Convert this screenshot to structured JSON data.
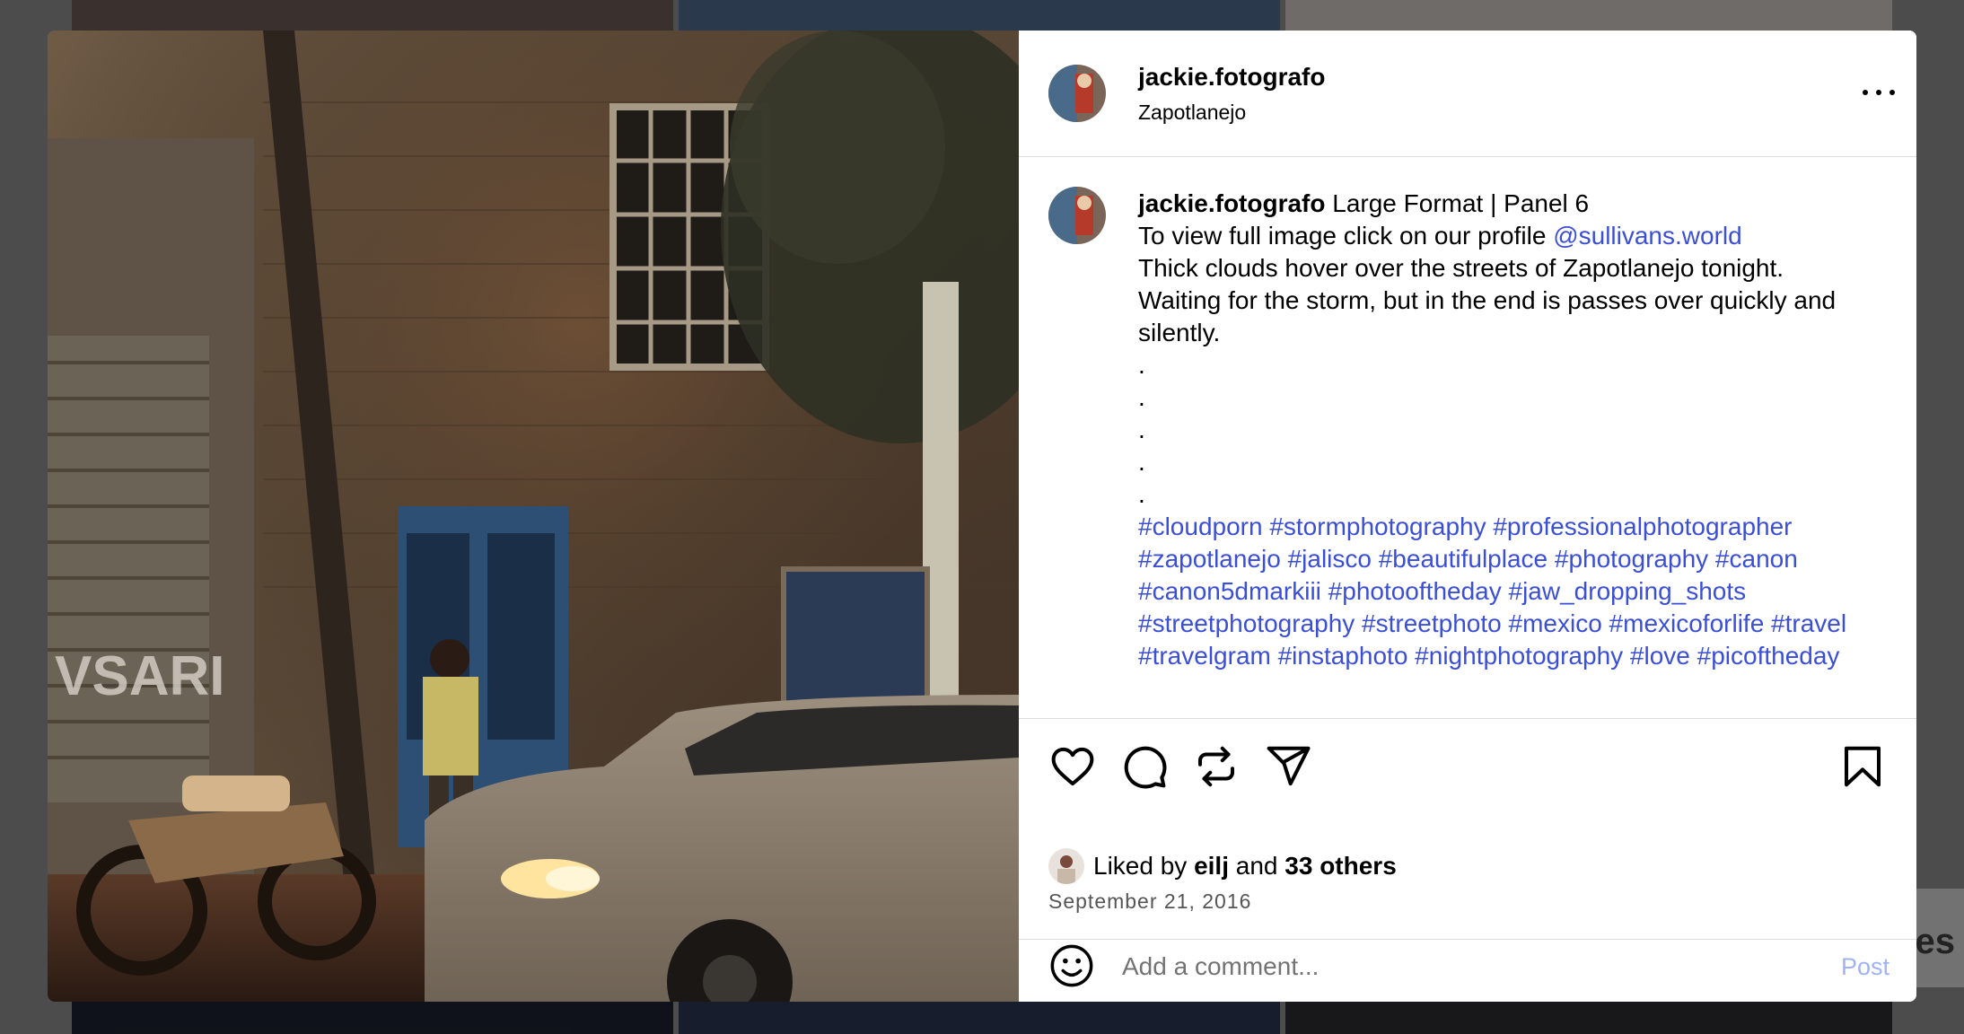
{
  "post": {
    "username": "jackie.fotografo",
    "location": "Zapotlanejo",
    "caption": {
      "title": "Large Format | Panel 6",
      "line1": "To view full image click on our profile",
      "mention": "@sullivans.world",
      "line2": "Thick clouds hover over the streets of Zapotlanejo tonight. Waiting for the storm, but in the end is passes over quickly and silently.",
      "dots": [
        ".",
        ".",
        ".",
        ".",
        "."
      ],
      "hashtags": "#cloudporn #stormphotography #professionalphotographer #zapotlanejo #jalisco #beautifulplace #photography #canon #canon5dmarkiii #photooftheday #jaw_dropping_shots #streetphotography #streetphoto #mexico #mexicoforlife #travel #travelgram #instaphoto #nightphotography #love #picoftheday"
    },
    "likes": {
      "prefix": "Liked by",
      "user": "eilj",
      "and": "and",
      "others": "33 others"
    },
    "date": "September 21, 2016"
  },
  "comment": {
    "placeholder": "Add a comment...",
    "post_label": "Post"
  },
  "icons": {
    "like": "heart-icon",
    "comment": "comment-icon",
    "repost": "repost-icon",
    "share": "share-icon",
    "save": "bookmark-icon",
    "more": "more-icon",
    "emoji": "emoji-icon"
  },
  "colors": {
    "link": "#3b4fd6",
    "post_button": "#9fb3f3",
    "divider": "#dbdbdb"
  },
  "background": {
    "partial_text": "es"
  }
}
